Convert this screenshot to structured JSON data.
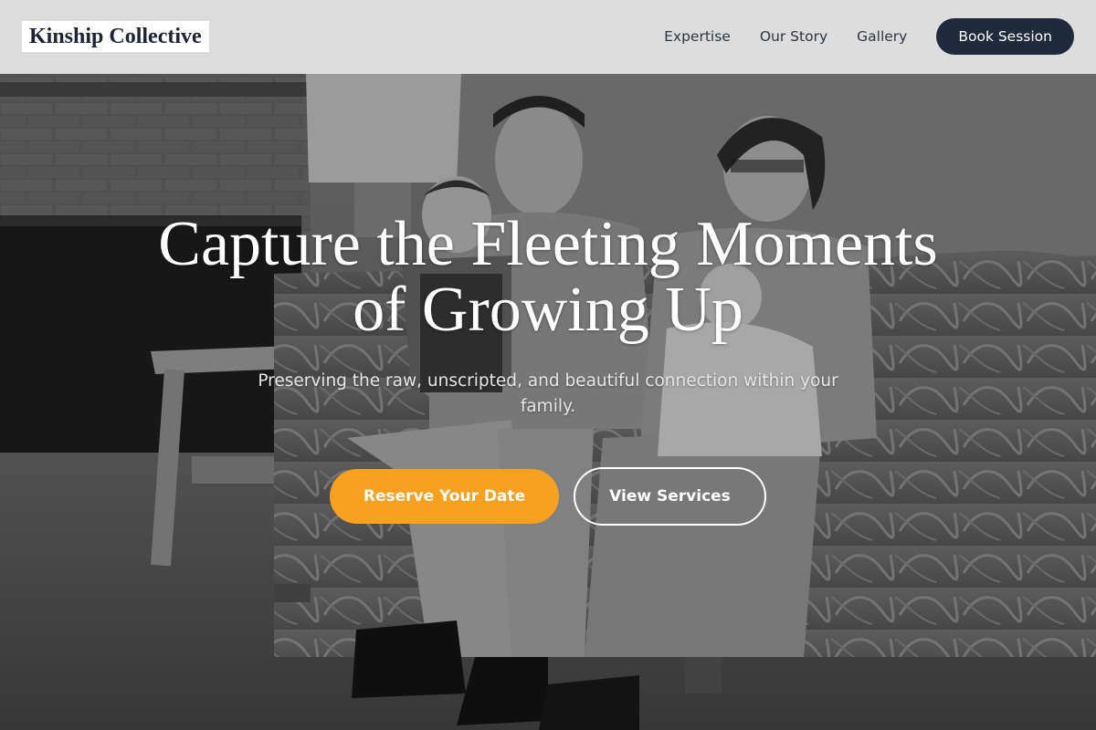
{
  "brand": {
    "name": "Kinship Collective"
  },
  "nav": {
    "links": [
      "Expertise",
      "Our Story",
      "Gallery"
    ],
    "cta_label": "Book Session"
  },
  "hero": {
    "title": "Capture the Fleeting Moments of Growing Up",
    "subtitle": "Preserving the raw, unscripted, and beautiful connection within your family.",
    "primary_label": "Reserve Your Date",
    "secondary_label": "View Services"
  },
  "colors": {
    "header_bg": "#e2e2e2",
    "brand_text": "#1b2434",
    "nav_cta_bg": "#1f2a3c",
    "accent": "#f8a01f",
    "hero_text": "#ffffff"
  },
  "background": {
    "icon": "vintage-family-photo",
    "style": "black-and-white"
  }
}
